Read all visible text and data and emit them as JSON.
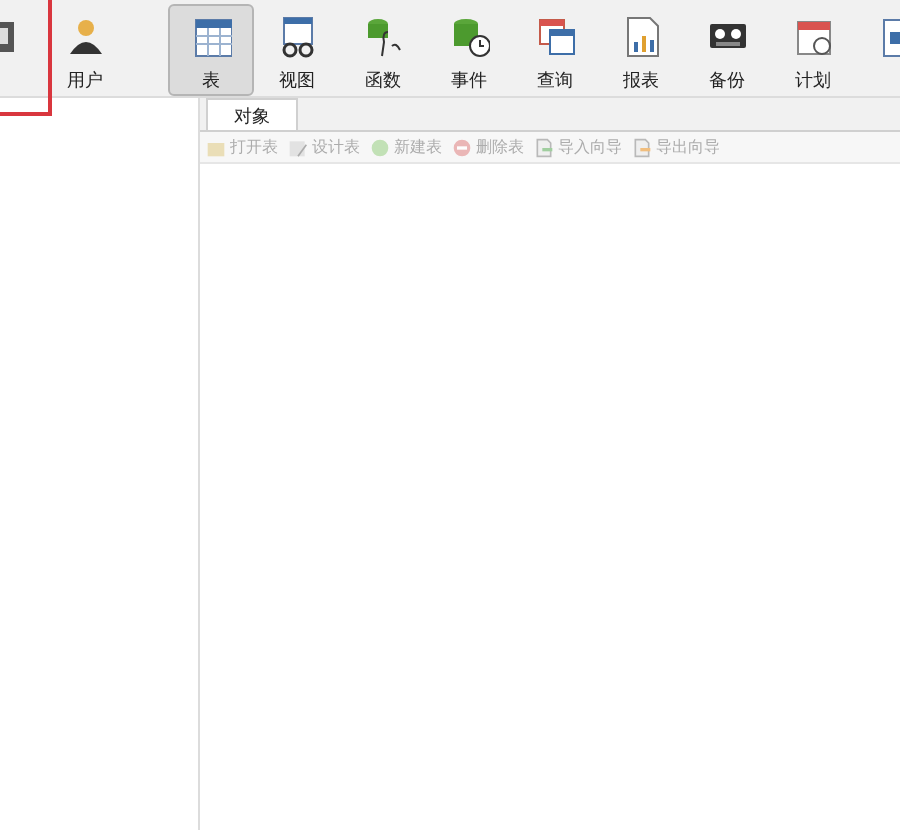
{
  "toolbar": [
    {
      "selected": false
    },
    {
      "label": "用户",
      "selected": false
    },
    {
      "label": "表",
      "selected": true
    },
    {
      "label": "视图",
      "selected": false
    },
    {
      "label": "函数",
      "selected": false
    },
    {
      "label": "事件",
      "selected": false
    },
    {
      "label": "查询",
      "selected": false
    },
    {
      "label": "报表",
      "selected": false
    },
    {
      "label": "备份",
      "selected": false
    },
    {
      "label": "计划",
      "selected": false
    },
    {
      "selected": false
    }
  ],
  "tabs": [
    {
      "label": "对象",
      "selected": true
    }
  ],
  "object_actions": [
    {
      "label": "打开表",
      "disabled": true
    },
    {
      "label": "设计表",
      "disabled": true
    },
    {
      "label": "新建表",
      "disabled": true
    },
    {
      "label": "删除表",
      "disabled": true
    },
    {
      "label": "导入向导",
      "disabled": true
    },
    {
      "label": "导出向导",
      "disabled": true
    }
  ]
}
